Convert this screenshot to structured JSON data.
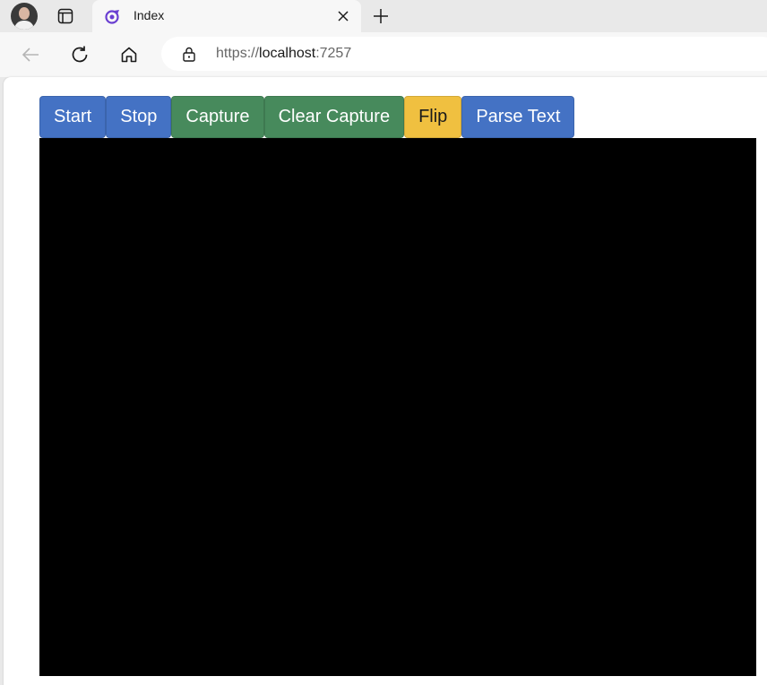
{
  "browser": {
    "tab": {
      "title": "Index"
    },
    "address_bar": {
      "scheme": "https://",
      "host": "localhost",
      "port": ":7257"
    }
  },
  "page": {
    "buttons": {
      "start": "Start",
      "stop": "Stop",
      "capture": "Capture",
      "clear_capture": "Clear Capture",
      "flip": "Flip",
      "parse_text": "Parse Text"
    }
  },
  "colors": {
    "primary": "#4472c4",
    "success": "#478a5c",
    "warning": "#f0c040",
    "canvas": "#000000"
  },
  "icons": {
    "tab_actions": "tab-actions-icon",
    "favicon": "blazor-favicon-icon",
    "close": "close-icon",
    "new_tab": "plus-icon",
    "back": "back-arrow-icon",
    "refresh": "refresh-icon",
    "home": "home-icon",
    "lock": "lock-icon"
  }
}
